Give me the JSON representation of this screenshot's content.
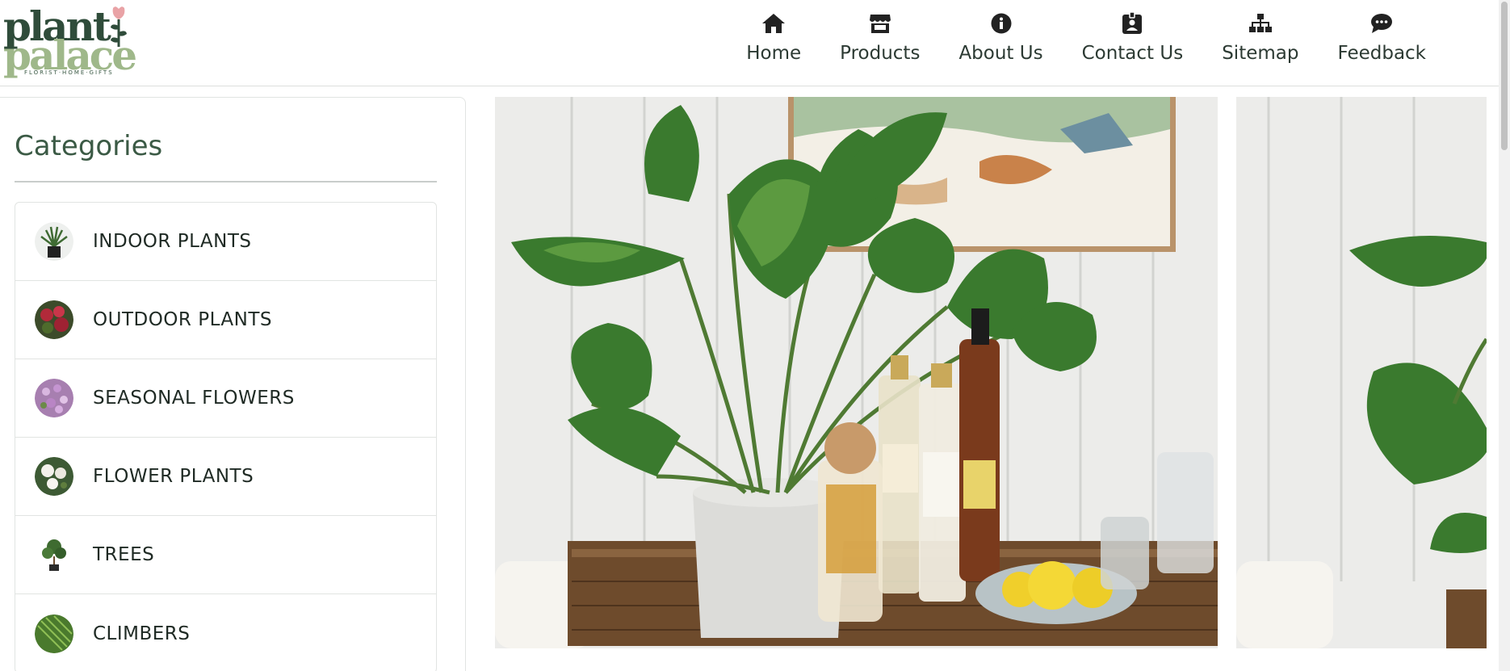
{
  "logo": {
    "line1": "plant",
    "line2": "palace",
    "tagline": "FLORIST·HOME·GIFTS"
  },
  "nav": [
    {
      "label": "Home",
      "icon": "home-icon"
    },
    {
      "label": "Products",
      "icon": "store-icon"
    },
    {
      "label": "About Us",
      "icon": "info-icon"
    },
    {
      "label": "Contact Us",
      "icon": "contact-card-icon"
    },
    {
      "label": "Sitemap",
      "icon": "sitemap-icon"
    },
    {
      "label": "Feedback",
      "icon": "chat-bubble-icon"
    }
  ],
  "sidebar": {
    "title": "Categories",
    "items": [
      {
        "label": "INDOOR PLANTS",
        "thumb": "indoor-plant-thumbnail"
      },
      {
        "label": "OUTDOOR PLANTS",
        "thumb": "outdoor-plant-thumbnail"
      },
      {
        "label": "SEASONAL FLOWERS",
        "thumb": "seasonal-flower-thumbnail"
      },
      {
        "label": "FLOWER PLANTS",
        "thumb": "flower-plant-thumbnail"
      },
      {
        "label": "TREES",
        "thumb": "tree-thumbnail"
      },
      {
        "label": "CLIMBERS",
        "thumb": "climber-thumbnail"
      }
    ]
  },
  "carousel": {
    "slides": [
      "monstera-on-bar-tray-photo",
      "monstera-on-bar-tray-photo"
    ]
  },
  "colors": {
    "brand_dark": "#2f4c3a",
    "brand_light": "#9fb88a",
    "text": "#2c3a33"
  }
}
